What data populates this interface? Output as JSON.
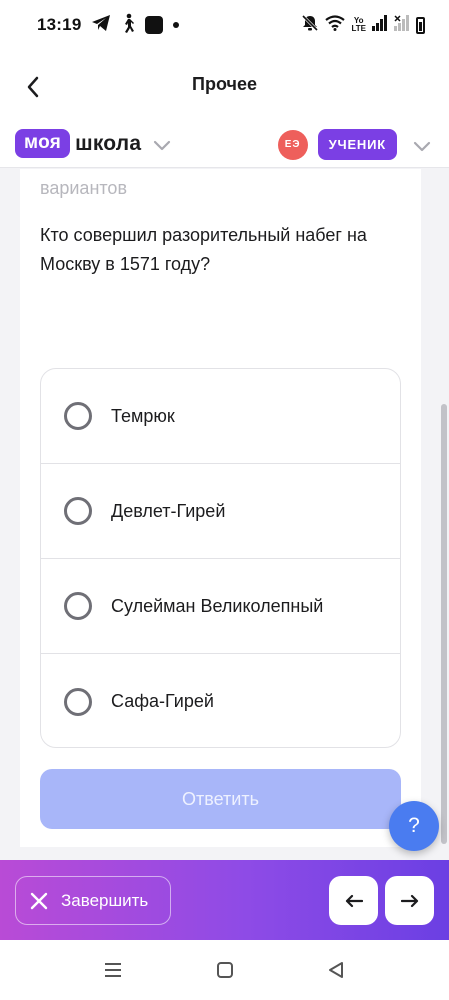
{
  "status_bar": {
    "time": "13:19",
    "lte_label_top": "Yo",
    "lte_label_bottom": "LTE"
  },
  "header": {
    "title": "Прочее",
    "brand_badge": "моя",
    "brand_word": "школа",
    "avatar_initials": "ЕЭ",
    "role": "УЧЕНИК"
  },
  "question": {
    "previous_text_fragment": "вариантов",
    "text": "Кто совершил разорительный набег на Москву в 1571 году?",
    "options": [
      {
        "label": "Темрюк"
      },
      {
        "label": "Девлет-Гирей"
      },
      {
        "label": "Сулейман Великолепный"
      },
      {
        "label": "Сафа-Гирей"
      }
    ],
    "submit_label": "Ответить"
  },
  "help": {
    "label": "?"
  },
  "bottom_bar": {
    "finish_label": "Завершить"
  },
  "colors": {
    "accent_purple": "#7b3fe4",
    "avatar_red": "#ee5f5b",
    "submit_disabled": "#a8b6f9",
    "help_blue": "#4a7cf0",
    "gradient_start": "#b94bd6",
    "gradient_end": "#6b3fe3"
  },
  "icons": {
    "back": "chevron-left-icon",
    "brand_dropdown": "chevron-down-icon",
    "user_dropdown": "chevron-down-icon",
    "finish": "close-icon",
    "prev": "arrow-left-icon",
    "next": "arrow-right-icon"
  }
}
